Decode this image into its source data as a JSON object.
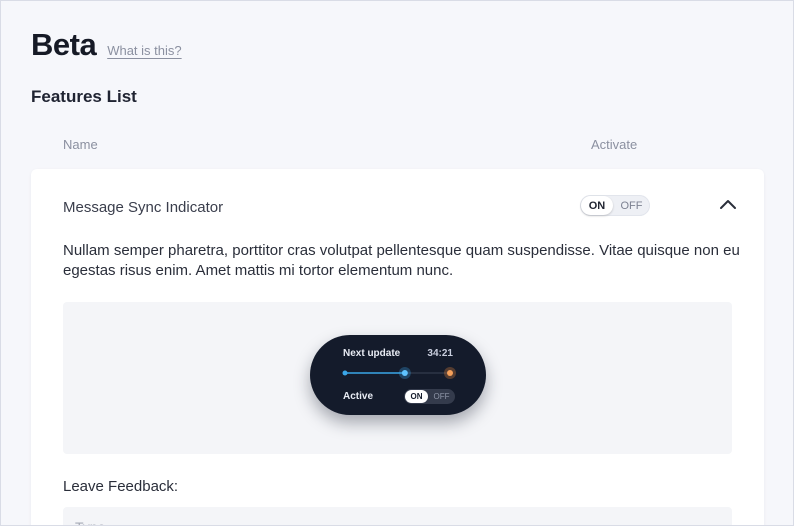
{
  "header": {
    "title": "Beta",
    "help_link": "What is this?"
  },
  "section": {
    "title": "Features List"
  },
  "table": {
    "columns": [
      "Name",
      "Activate"
    ]
  },
  "feature": {
    "name": "Message Sync Indicator",
    "toggle": {
      "on_label": "ON",
      "off_label": "OFF",
      "state": "ON"
    },
    "expanded": true,
    "description": "Nullam semper pharetra, porttitor cras volutpat pellentesque quam suspendisse. Vitae quisque non eu egestas risus enim. Amet mattis mi tortor elementum nunc.",
    "preview": {
      "next_update_label": "Next update",
      "next_update_time": "34:21",
      "active_label": "Active",
      "toggle_on": "ON",
      "toggle_off": "OFF",
      "progress_fraction": 0.57
    },
    "feedback": {
      "label": "Leave Feedback:",
      "placeholder": "Type..."
    }
  },
  "colors": {
    "background": "#f6f7fb",
    "card": "#ffffff",
    "widget_background": "#141b2b",
    "progress_blue": "#3aa6e8",
    "marker_orange": "#f08a3a"
  },
  "icons": {
    "collapse": "chevron-up-icon"
  }
}
